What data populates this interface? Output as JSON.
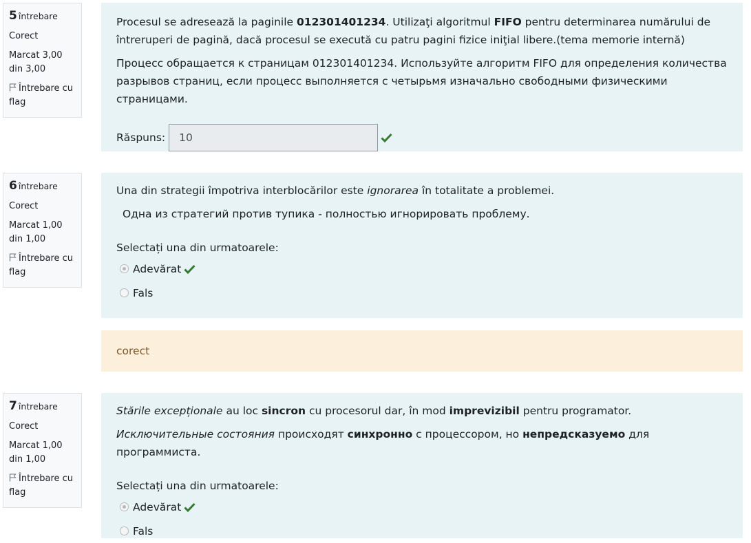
{
  "questions": [
    {
      "number": "5",
      "word": "întrebare",
      "status": "Corect",
      "mark": "Marcat 3,00 din 3,00",
      "flag": "Întrebare cu flag",
      "text_ro": {
        "p1": "Procesul se adresează la paginile ",
        "b1": "012301401234",
        "p2": ". Utilizaţi algoritmul ",
        "b2": "FIFO",
        "p3": " pentru determinarea numărului de întreruperi de pagină, dacă procesul se execută cu patru pagini fizice iniţial libere.(tema memorie internă)"
      },
      "text_ru": "Процесс обращается к страницам 012301401234. Используйте алгоритм FIFO для определения количества разрывов страниц, если процесс выполняется с четырьмя изначально свободными физическими страницами.",
      "answer_label": "Răspuns:",
      "answer_value": "10"
    },
    {
      "number": "6",
      "word": "întrebare",
      "status": "Corect",
      "mark": "Marcat 1,00 din 1,00",
      "flag": "Întrebare cu flag",
      "text_ro": {
        "p1": "Una din strategii împotriva interblocărilor este ",
        "i1": "ignorarea",
        "p2": " în totalitate a problemei."
      },
      "text_ru": "Одна из стратегий против тупика - полностью игнорировать проблему.",
      "select_prompt": "Selectați una din urmatoarele:",
      "options": [
        "Adevărat",
        "Fals"
      ],
      "selected": "Adevărat",
      "feedback": "corect"
    },
    {
      "number": "7",
      "word": "întrebare",
      "status": "Corect",
      "mark": "Marcat 1,00 din 1,00",
      "flag": "Întrebare cu flag",
      "text_ro": {
        "i1": "Stările excepționale",
        "p1": " au loc ",
        "b1": "sincron",
        "p2": " cu procesorul dar, în mod ",
        "b2": "imprevizibil",
        "p3": " pentru  programator."
      },
      "text_ru": {
        "i1": "Исключительные состояния",
        "p1": " происходят ",
        "b1": "синхронно",
        "p2": " с процессором, но ",
        "b2": "непредсказуемо",
        "p3": " для программиста."
      },
      "select_prompt": "Selectați una din urmatoarele:",
      "options": [
        "Adevărat",
        "Fals"
      ],
      "selected": "Adevărat"
    }
  ],
  "colors": {
    "content_bg": "#e7f3f5",
    "info_bg": "#f8f9fa",
    "feedback_bg": "#fcefdc",
    "correct": "#357a32"
  },
  "icons": [
    "flag-icon",
    "check-icon"
  ]
}
